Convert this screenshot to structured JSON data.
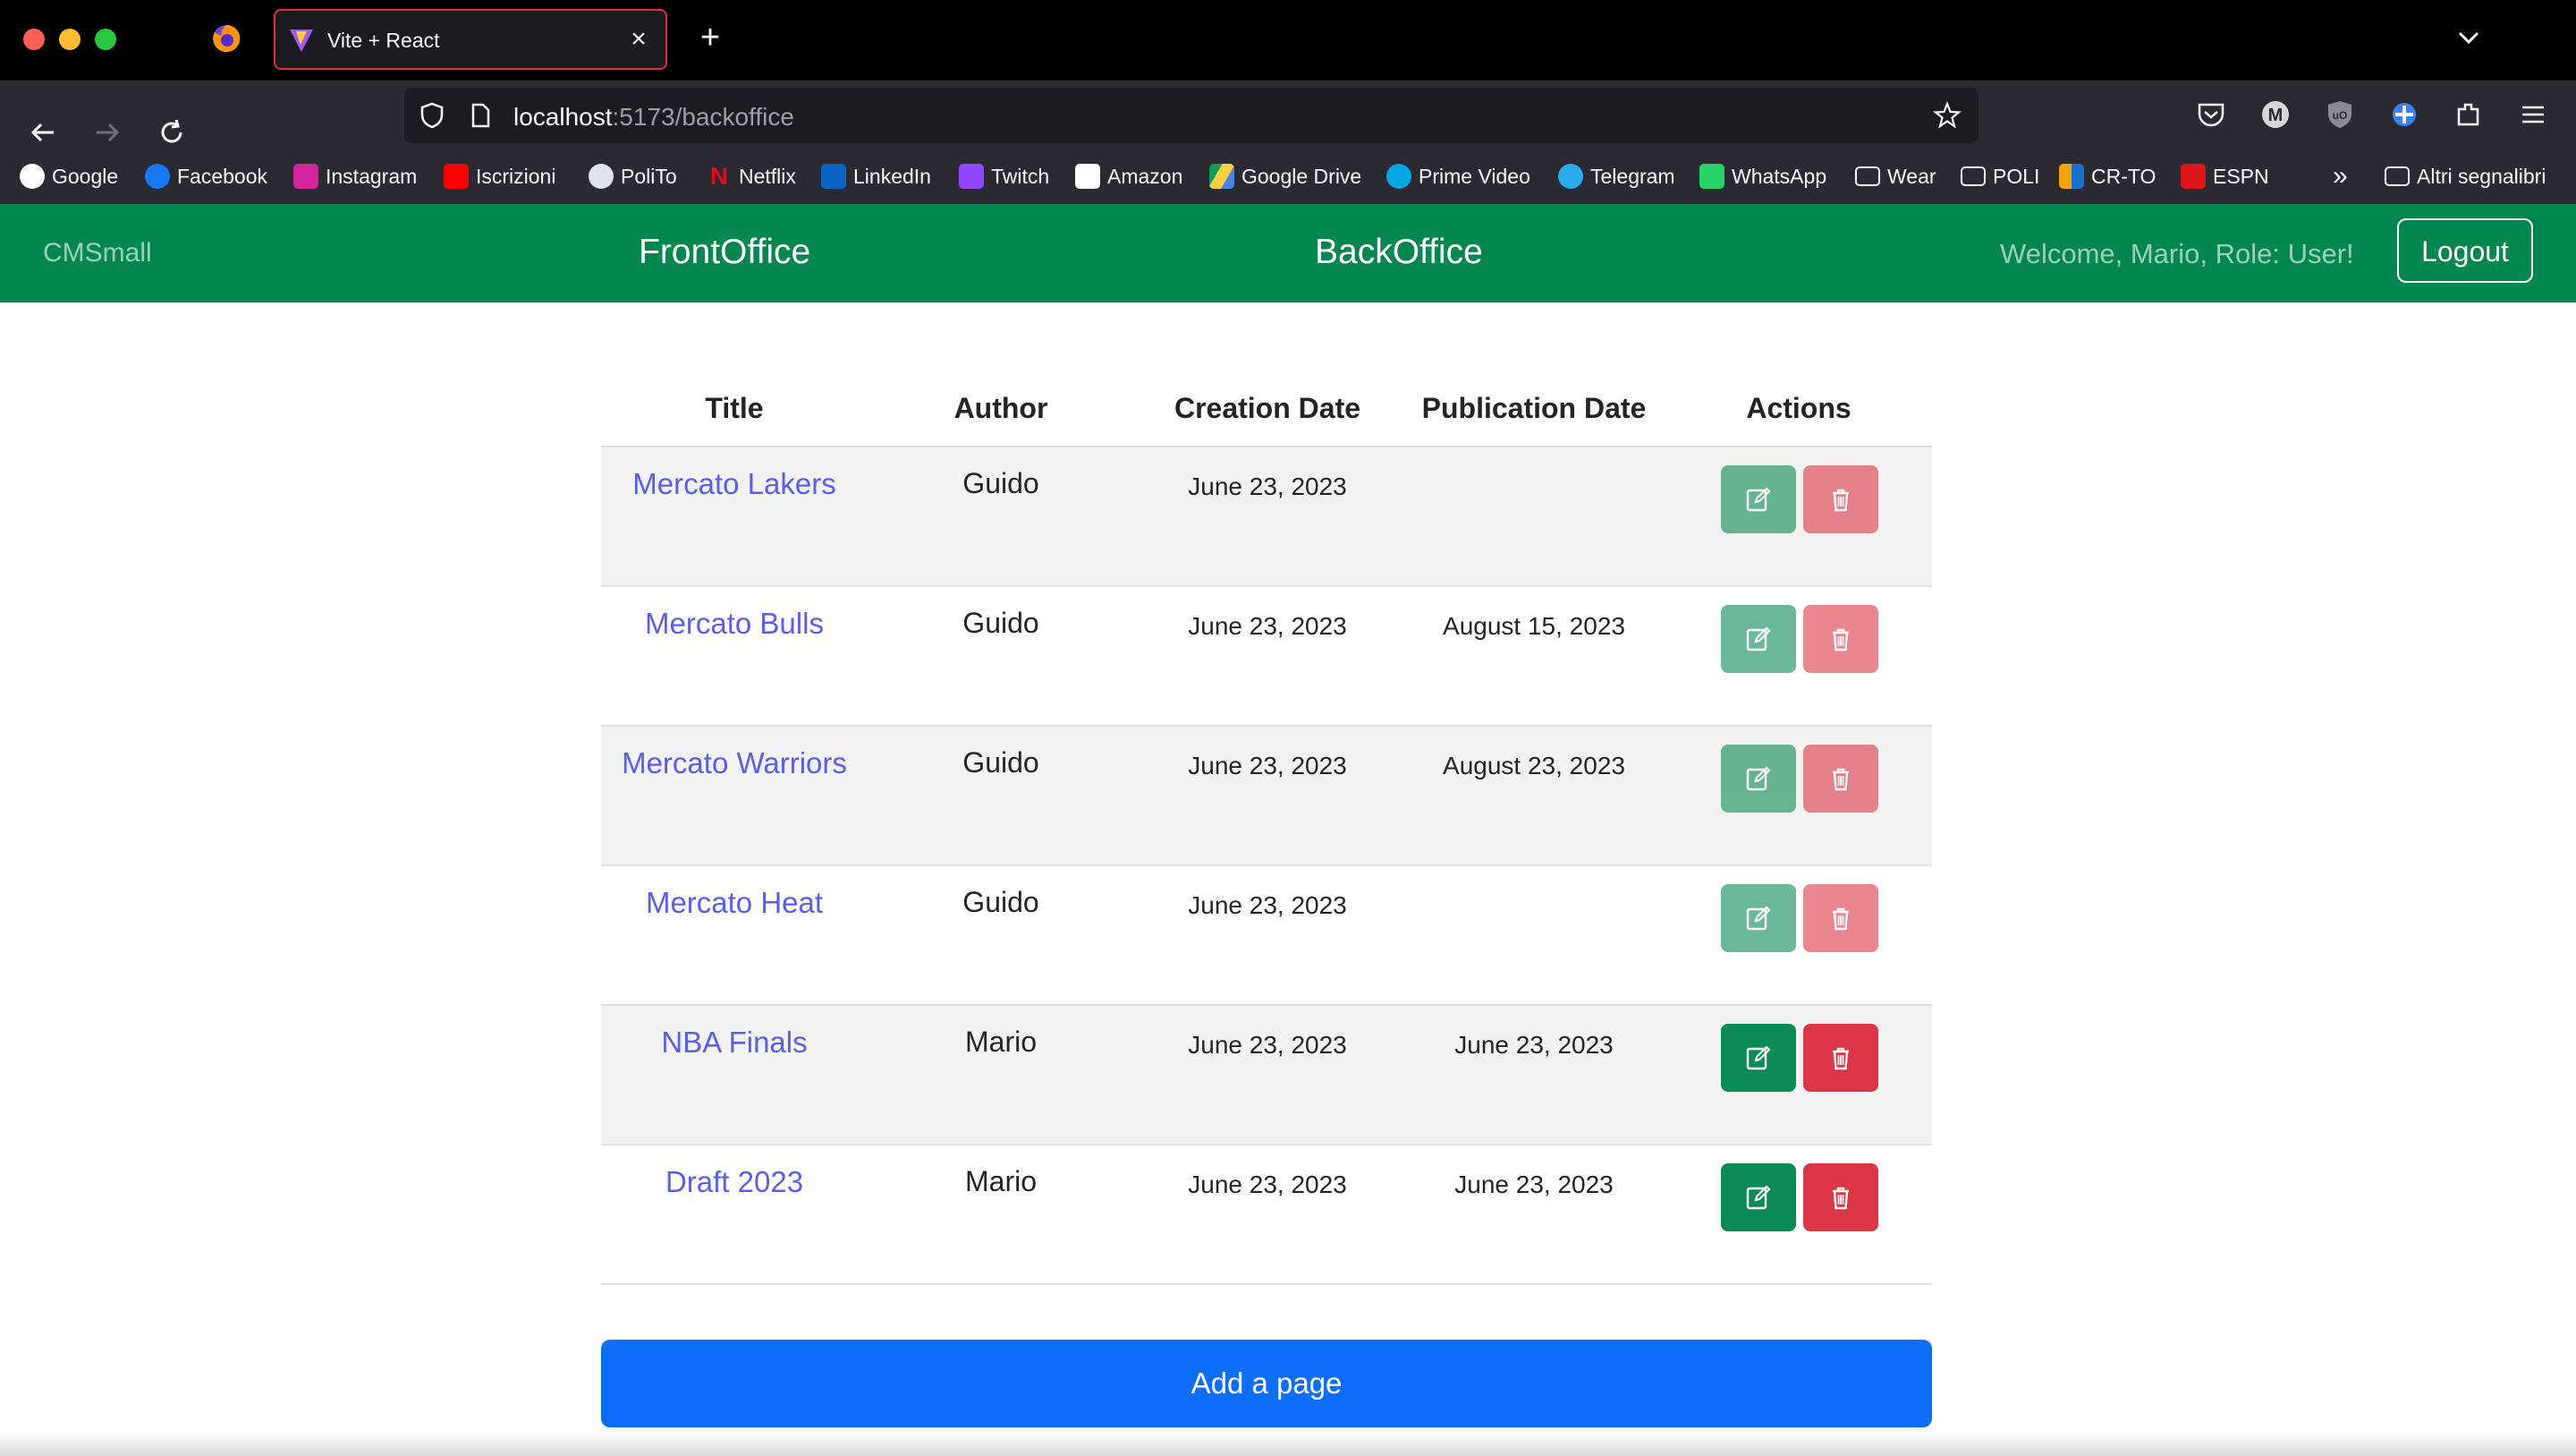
{
  "browser": {
    "tab_title": "Vite + React",
    "url_host": "localhost",
    "url_path": ":5173/backoffice",
    "bookmarks": [
      "Google",
      "Facebook",
      "Instagram",
      "Iscrizioni",
      "PoliTo",
      "Netflix",
      "LinkedIn",
      "Twitch",
      "Amazon",
      "Google Drive",
      "Prime Video",
      "Telegram",
      "WhatsApp",
      "Wear",
      "POLI",
      "CR-TO",
      "ESPN"
    ],
    "other_bookmarks": "Altri segnalibri"
  },
  "app": {
    "brand": "CMSmall",
    "nav_front": "FrontOffice",
    "nav_back": "BackOffice",
    "welcome": "Welcome, Mario, Role: User!",
    "logout": "Logout",
    "accent": "#03874f"
  },
  "table": {
    "headers": [
      "Title",
      "Author",
      "Creation Date",
      "Publication Date",
      "Actions"
    ],
    "rows": [
      {
        "title": "Mercato Lakers",
        "author": "Guido",
        "created": "June 23, 2023",
        "published": "",
        "editable": false
      },
      {
        "title": "Mercato Bulls",
        "author": "Guido",
        "created": "June 23, 2023",
        "published": "August 15, 2023",
        "editable": false
      },
      {
        "title": "Mercato Warriors",
        "author": "Guido",
        "created": "June 23, 2023",
        "published": "August 23, 2023",
        "editable": false
      },
      {
        "title": "Mercato Heat",
        "author": "Guido",
        "created": "June 23, 2023",
        "published": "",
        "editable": false
      },
      {
        "title": "NBA Finals",
        "author": "Mario",
        "created": "June 23, 2023",
        "published": "June 23, 2023",
        "editable": true
      },
      {
        "title": "Draft 2023",
        "author": "Mario",
        "created": "June 23, 2023",
        "published": "June 23, 2023",
        "editable": true
      }
    ]
  },
  "add_button": "Add a page"
}
